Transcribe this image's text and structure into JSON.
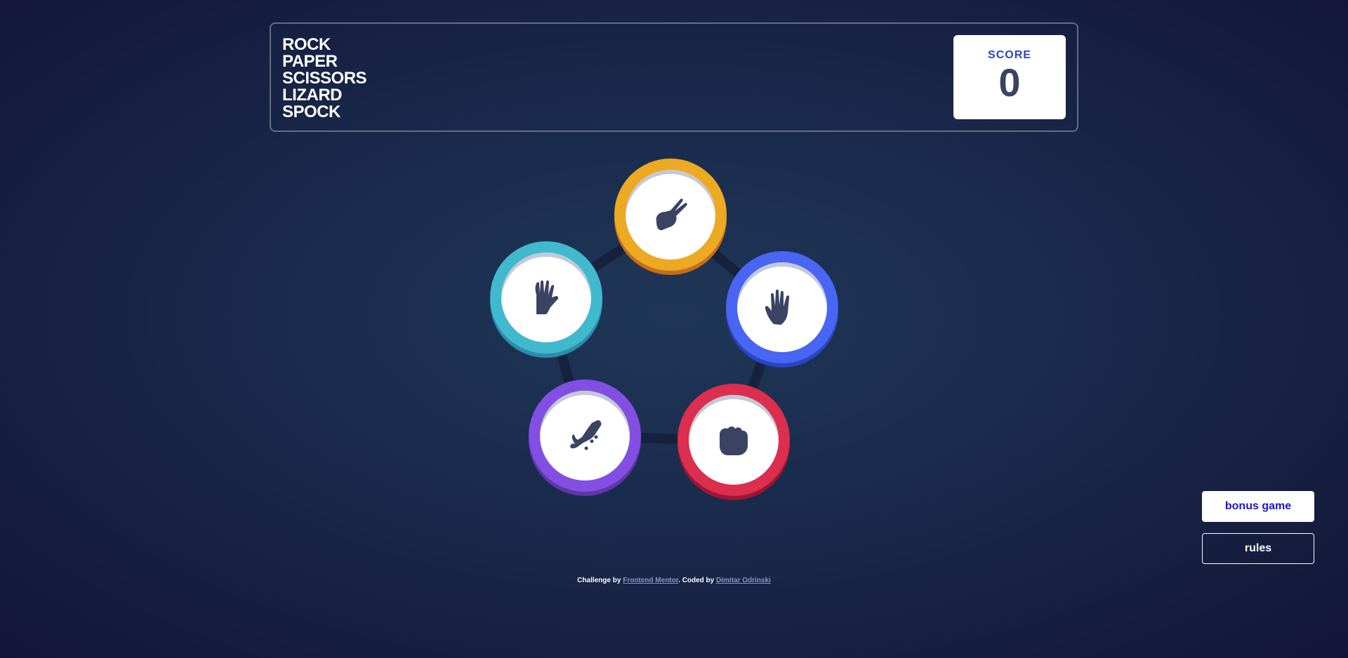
{
  "header": {
    "title_lines": [
      "ROCK",
      "PAPER",
      "SCISSORS",
      "LIZARD",
      "SPOCK"
    ],
    "score_label": "SCORE",
    "score_value": "0"
  },
  "tokens": [
    {
      "id": "scissors",
      "icon": "scissors-hand-icon",
      "color": "#eca922"
    },
    {
      "id": "paper",
      "icon": "paper-hand-icon",
      "color": "#4865f4"
    },
    {
      "id": "rock",
      "icon": "rock-fist-icon",
      "color": "#dc2e4e"
    },
    {
      "id": "lizard",
      "icon": "lizard-icon",
      "color": "#834fe3"
    },
    {
      "id": "spock",
      "icon": "spock-hand-icon",
      "color": "#40b9ce"
    }
  ],
  "buttons": {
    "bonus_label": "bonus game",
    "rules_label": "rules"
  },
  "footer": {
    "prefix": "Challenge by",
    "link1": "Frontend Mentor",
    "middle": ". Coded by",
    "link2": "Dimitar Odrinski"
  },
  "colors": {
    "background": "#1f3757",
    "accent_blue": "#2a45c2",
    "text_dark": "#3b4363"
  }
}
